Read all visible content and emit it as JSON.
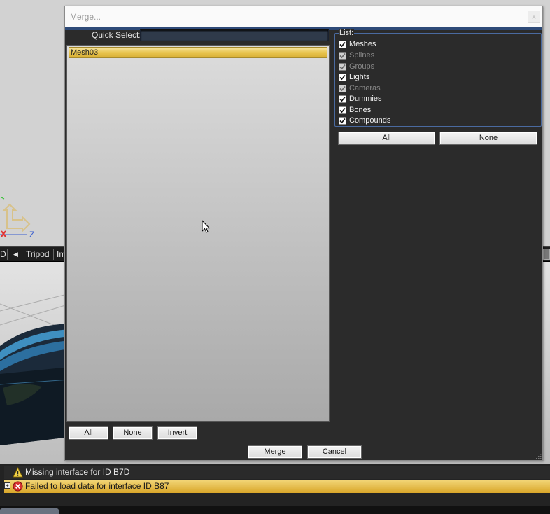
{
  "background": {
    "axis_label": "Z",
    "toolbar": {
      "left_label": "D",
      "tripod_label": "Tripod",
      "next_label": "Im"
    },
    "log": {
      "warning_message": "Missing interface for ID B7D",
      "error_message": "Failed to load data for interface ID B87"
    }
  },
  "dialog": {
    "title": "Merge...",
    "close_glyph": "x",
    "quick_select": {
      "label": "Quick Select:",
      "value": "",
      "placeholder": ""
    },
    "objects": [
      {
        "name": "Mesh03",
        "selected": true
      }
    ],
    "list_buttons": {
      "all": "All",
      "none": "None",
      "invert": "Invert"
    },
    "list_filter": {
      "legend": "List:",
      "items": [
        {
          "label": "Meshes",
          "checked": true,
          "enabled": true
        },
        {
          "label": "Splines",
          "checked": true,
          "enabled": false
        },
        {
          "label": "Groups",
          "checked": true,
          "enabled": false
        },
        {
          "label": "Lights",
          "checked": true,
          "enabled": true
        },
        {
          "label": "Cameras",
          "checked": true,
          "enabled": false
        },
        {
          "label": "Dummies",
          "checked": true,
          "enabled": true
        },
        {
          "label": "Bones",
          "checked": true,
          "enabled": true
        },
        {
          "label": "Compounds",
          "checked": true,
          "enabled": true
        }
      ],
      "all_label": "All",
      "none_label": "None"
    },
    "merge_label": "Merge",
    "cancel_label": "Cancel"
  },
  "colors": {
    "selection_gold": "#e8c44e",
    "dialog_bg": "#2b2b2b",
    "accent_blue": "#2e4a78"
  }
}
